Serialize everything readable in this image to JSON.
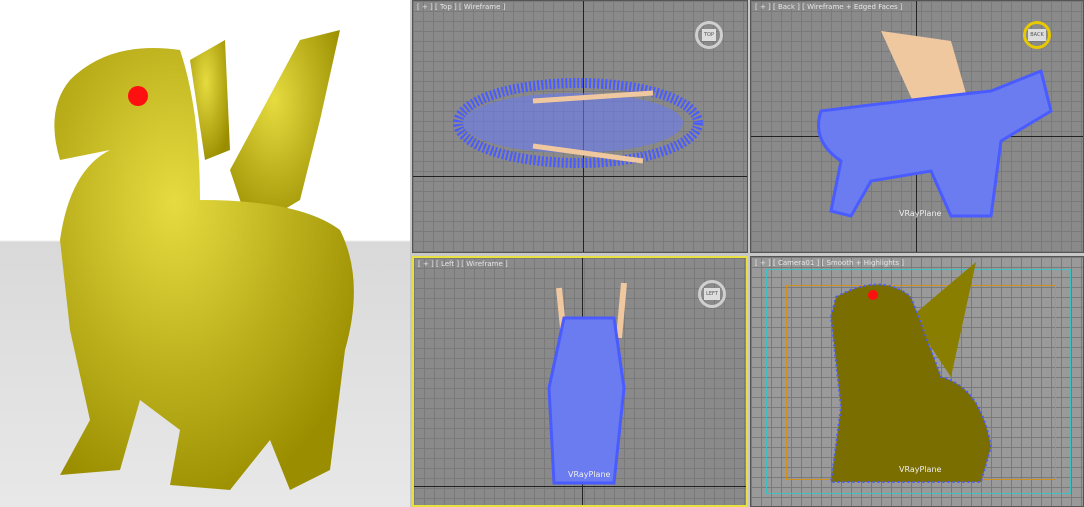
{
  "viewports": [
    {
      "label": "[ + ] [ Top ] [ Wireframe ]",
      "cube": "TOP"
    },
    {
      "label": "[ + ] [ Back ] [ Wireframe + Edged Faces ]",
      "cube": "BACK",
      "plane": "VRayPlane"
    },
    {
      "label": "[ + ] [ Left ] [ Wireframe ]",
      "cube": "LEFT",
      "plane": "VRayPlane",
      "active": true
    },
    {
      "label": "[ + ] [ Camera01 ] [ Smooth + Highlights ]",
      "plane": "VRayPlane"
    }
  ],
  "colors": {
    "model": "#d4c41a",
    "wire": "#4a5cff",
    "wings": "#f0c8a0",
    "active_border": "#e8e040",
    "eye": "#ff1010"
  }
}
